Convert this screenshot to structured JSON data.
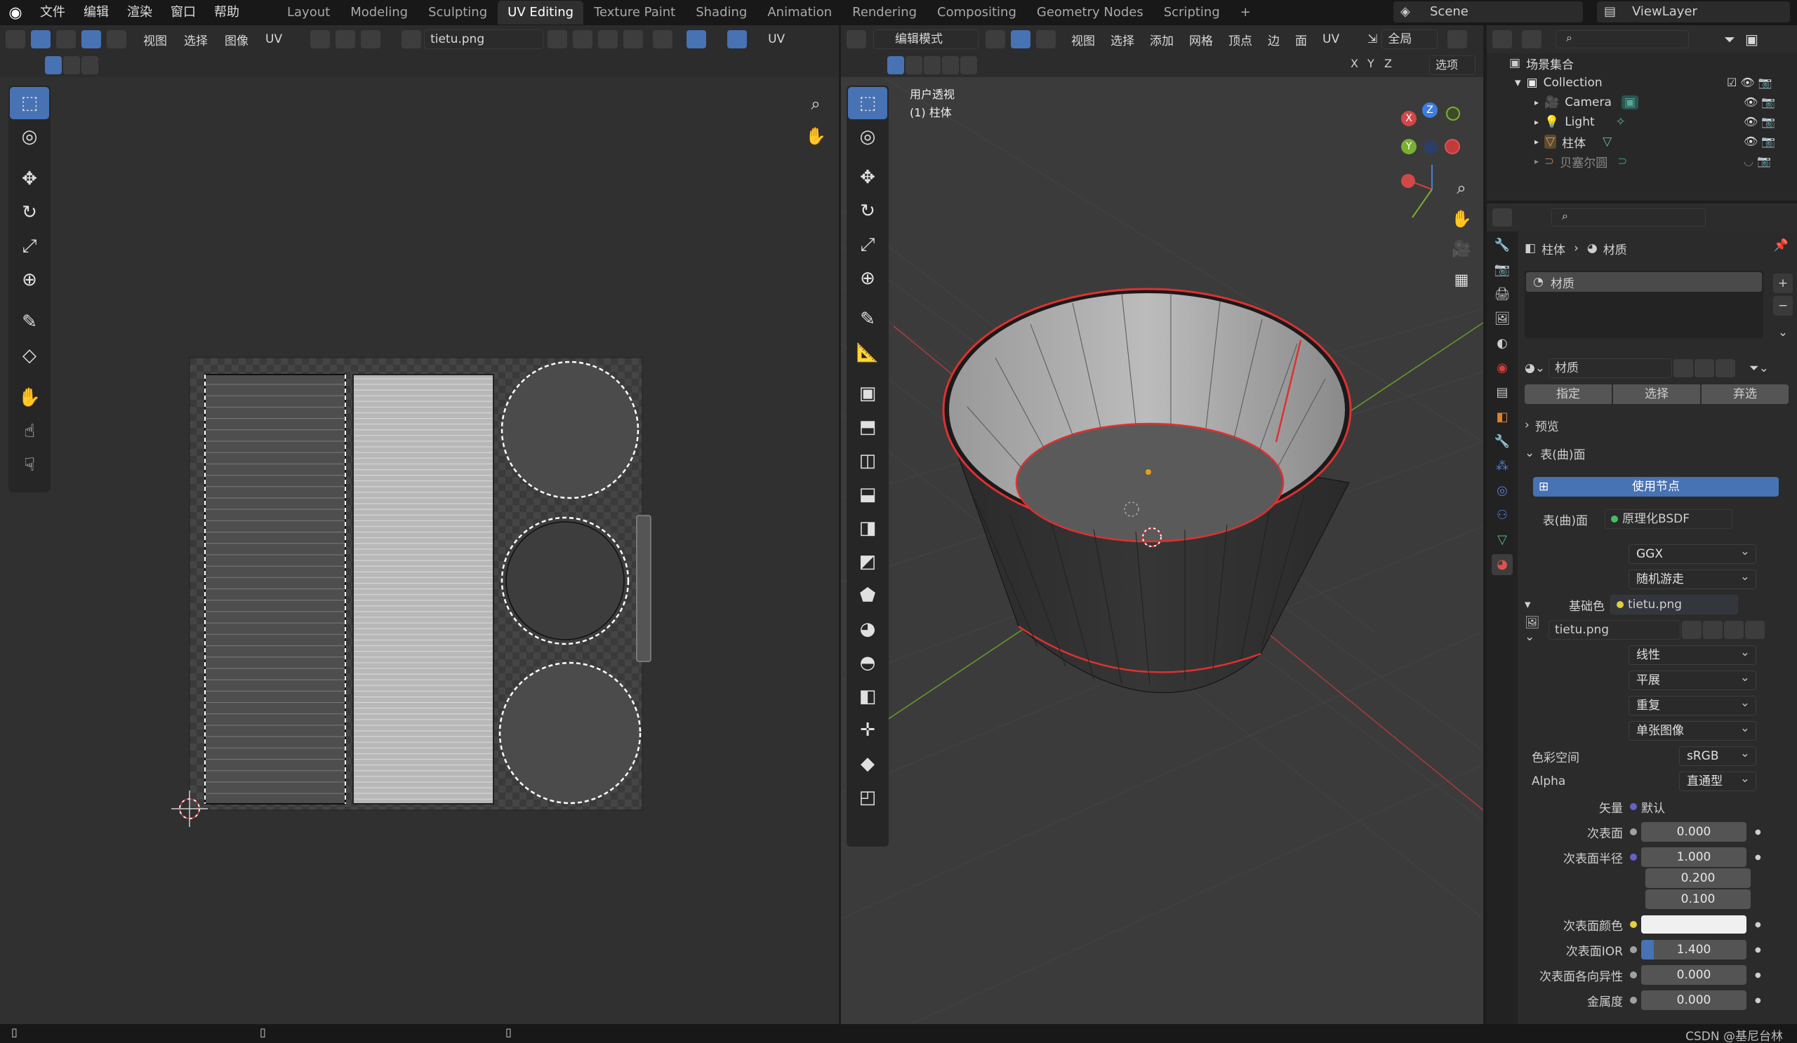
{
  "menu": {
    "file": "文件",
    "edit": "编辑",
    "render": "渲染",
    "window": "窗口",
    "help": "帮助"
  },
  "workspaces": [
    "Layout",
    "Modeling",
    "Sculpting",
    "UV Editing",
    "Texture Paint",
    "Shading",
    "Animation",
    "Rendering",
    "Compositing",
    "Geometry Nodes",
    "Scripting"
  ],
  "add_tab": "+",
  "scene": "Scene",
  "view_layer": "ViewLayer",
  "uv_editor": {
    "menus": [
      "视图",
      "选择",
      "图像",
      "UV"
    ],
    "image_name": "tietu.png",
    "extra": "UV"
  },
  "viewport": {
    "mode": "编辑模式",
    "menus": [
      "视图",
      "选择",
      "添加",
      "网格",
      "顶点",
      "边",
      "面",
      "UV"
    ],
    "transform": "全局",
    "axes": [
      "X",
      "Y",
      "Z"
    ],
    "options": "选项",
    "overlay_title": "用户透视",
    "overlay_object": "(1) 柱体",
    "gizmo": {
      "x": "X",
      "y": "Y",
      "z": "Z"
    }
  },
  "outliner": {
    "root": "场景集合",
    "collection": "Collection",
    "items": [
      "Camera",
      "Light",
      "柱体",
      "贝塞尔圆"
    ]
  },
  "properties": {
    "breadcrumb_obj": "柱体",
    "breadcrumb_mat": "材质",
    "slot": "材质",
    "material_name": "材质",
    "assign": "指定",
    "select": "选择",
    "deselect": "弃选",
    "preview": "预览",
    "surface_section": "表(曲)面",
    "use_nodes": "使用节点",
    "surface_label": "表(曲)面",
    "surface_value": "原理化BSDF",
    "distribution": "GGX",
    "subsurface_method": "随机游走",
    "base_color_label": "基础色",
    "base_color_value": "tietu.png",
    "image_name": "tietu.png",
    "interpolation": "线性",
    "projection": "平展",
    "extension": "重复",
    "source": "单张图像",
    "colorspace_label": "色彩空间",
    "colorspace_value": "sRGB",
    "alpha_label": "Alpha",
    "alpha_value": "直通型",
    "vector_label": "矢量",
    "vector_value": "默认",
    "subsurface_label": "次表面",
    "subsurface_value": "0.000",
    "radius_label": "次表面半径",
    "radius_values": [
      "1.000",
      "0.200",
      "0.100"
    ],
    "ss_color_label": "次表面颜色",
    "ss_ior_label": "次表面IOR",
    "ss_ior_value": "1.400",
    "ss_aniso_label": "次表面各向异性",
    "ss_aniso_value": "0.000",
    "metallic_label": "金属度",
    "metallic_value": "0.000"
  },
  "watermark": "CSDN @基尼台林",
  "colors": {
    "accent": "#4772b3",
    "selection": "#e03030",
    "bg": "#1d1d1d"
  }
}
